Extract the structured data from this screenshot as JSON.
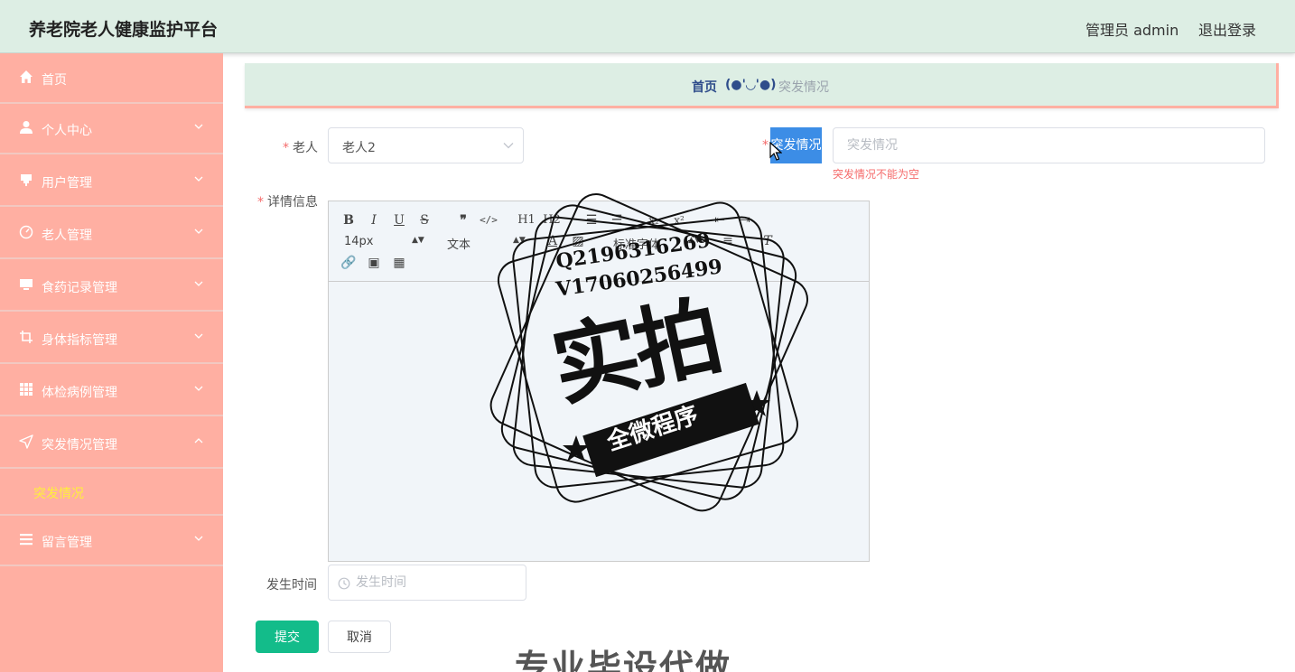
{
  "header": {
    "app_title": "养老院老人健康监护平台",
    "admin_label": "管理员 admin",
    "logout_label": "退出登录"
  },
  "sidebar": {
    "items": [
      {
        "label": "首页",
        "icon": "home-icon",
        "expandable": false
      },
      {
        "label": "个人中心",
        "icon": "user-icon",
        "expandable": true
      },
      {
        "label": "用户管理",
        "icon": "users-icon",
        "expandable": true
      },
      {
        "label": "老人管理",
        "icon": "gauge-icon",
        "expandable": true
      },
      {
        "label": "食药记录管理",
        "icon": "monitor-icon",
        "expandable": true
      },
      {
        "label": "身体指标管理",
        "icon": "crop-icon",
        "expandable": true
      },
      {
        "label": "体检病例管理",
        "icon": "grid-icon",
        "expandable": true
      },
      {
        "label": "突发情况管理",
        "icon": "location-arrow-icon",
        "expandable": true,
        "expanded": true
      },
      {
        "label": "留言管理",
        "icon": "list-icon",
        "expandable": true
      }
    ],
    "active_submenu": "突发情况",
    "active_color": "#fff03a",
    "background_color": "#ffafa2"
  },
  "breadcrumb": {
    "home": "首页",
    "separator": "(●'◡'●)",
    "current": "突发情况"
  },
  "form": {
    "elder_label": "老人",
    "elder_value": "老人2",
    "emergency_label": "突发情况",
    "emergency_placeholder": "突发情况",
    "emergency_error": "突发情况不能为空",
    "details_label": "详情信息",
    "time_label": "发生时间",
    "time_placeholder": "发生时间",
    "submit_label": "提交",
    "cancel_label": "取消",
    "submit_color": "#13bc8a"
  },
  "editor_toolbar": {
    "font_size": "14px",
    "text_type": "文本",
    "font_family": "标准字体",
    "h1": "H1",
    "h2": "H2"
  },
  "watermark": {
    "line1": "Q2196316269",
    "line2": "V17060256499",
    "big": "实拍",
    "banner": "全微程序",
    "bottom": "专业毕设代做"
  }
}
